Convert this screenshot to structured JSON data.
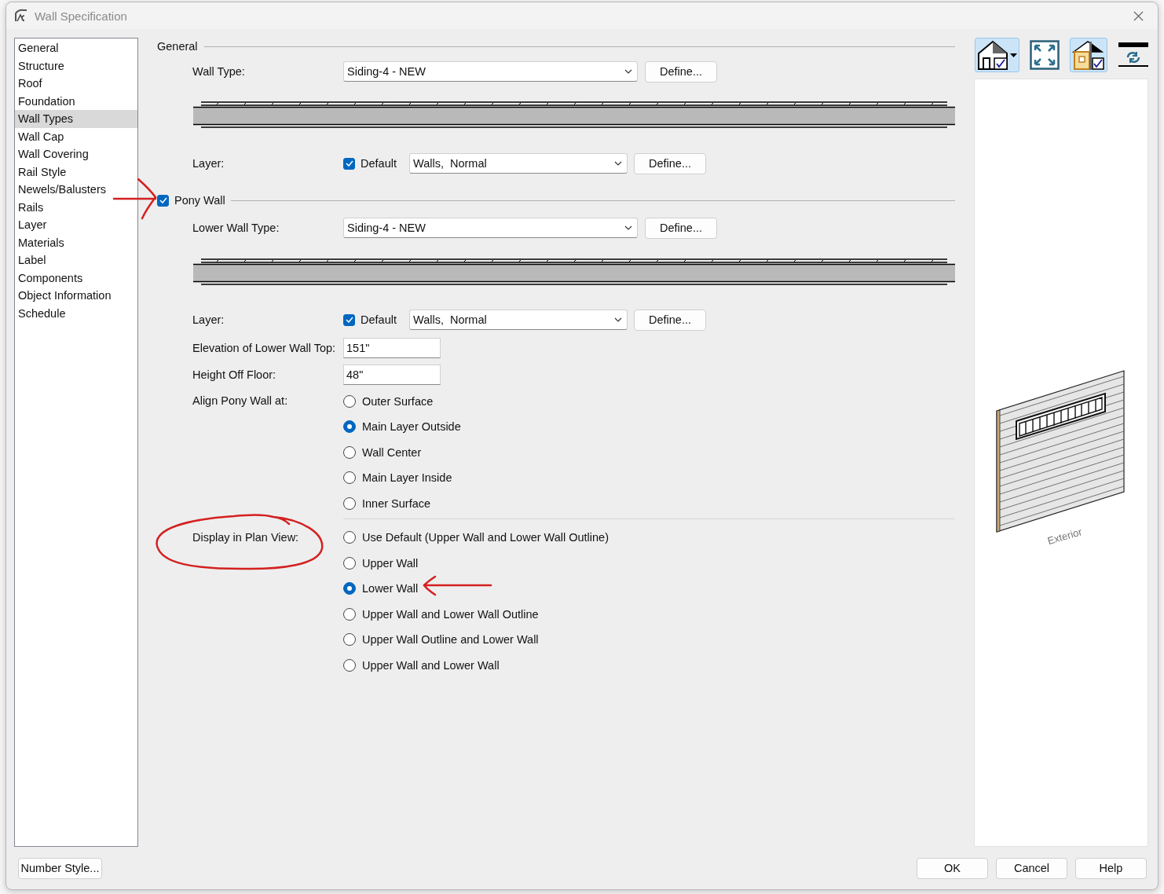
{
  "window": {
    "title": "Wall Specification"
  },
  "sidebar": {
    "items": [
      {
        "label": "General",
        "selected": false
      },
      {
        "label": "Structure",
        "selected": false
      },
      {
        "label": "Roof",
        "selected": false
      },
      {
        "label": "Foundation",
        "selected": false
      },
      {
        "label": "Wall Types",
        "selected": true
      },
      {
        "label": "Wall Cap",
        "selected": false
      },
      {
        "label": "Wall Covering",
        "selected": false
      },
      {
        "label": "Rail Style",
        "selected": false
      },
      {
        "label": "Newels/Balusters",
        "selected": false
      },
      {
        "label": "Rails",
        "selected": false
      },
      {
        "label": "Layer",
        "selected": false
      },
      {
        "label": "Materials",
        "selected": false
      },
      {
        "label": "Label",
        "selected": false
      },
      {
        "label": "Components",
        "selected": false
      },
      {
        "label": "Object Information",
        "selected": false
      },
      {
        "label": "Schedule",
        "selected": false
      }
    ]
  },
  "general": {
    "heading": "General",
    "wall_type": {
      "label": "Wall Type:",
      "value": "Siding-4 - NEW",
      "button": "Define..."
    },
    "layer": {
      "label": "Layer:",
      "default_checked": true,
      "default_label": "Default",
      "value": "Walls,  Normal",
      "button": "Define..."
    }
  },
  "pony_wall": {
    "label": "Pony Wall",
    "checked": true,
    "lower_wall_type": {
      "label": "Lower Wall Type:",
      "value": "Siding-4 - NEW",
      "button": "Define..."
    },
    "layer": {
      "label": "Layer:",
      "default_checked": true,
      "default_label": "Default",
      "value": "Walls,  Normal",
      "button": "Define..."
    },
    "elevation": {
      "label": "Elevation of Lower Wall Top:",
      "value": "151\""
    },
    "height_off_floor": {
      "label": "Height Off Floor:",
      "value": "48\""
    },
    "align": {
      "label": "Align Pony Wall at:",
      "options": [
        {
          "label": "Outer Surface",
          "selected": false
        },
        {
          "label": "Main Layer Outside",
          "selected": true
        },
        {
          "label": "Wall Center",
          "selected": false
        },
        {
          "label": "Main Layer Inside",
          "selected": false
        },
        {
          "label": "Inner Surface",
          "selected": false
        }
      ]
    },
    "display": {
      "label": "Display in Plan View:",
      "options": [
        {
          "label": "Use Default (Upper Wall and Lower Wall Outline)",
          "selected": false
        },
        {
          "label": "Upper Wall",
          "selected": false
        },
        {
          "label": "Lower Wall",
          "selected": true
        },
        {
          "label": "Upper Wall and Lower Wall Outline",
          "selected": false
        },
        {
          "label": "Upper Wall Outline and Lower Wall",
          "selected": false
        },
        {
          "label": "Upper Wall and Lower Wall",
          "selected": false
        }
      ]
    }
  },
  "toolbar": [
    {
      "kind": "house-view",
      "selected": true
    },
    {
      "kind": "fill-window",
      "selected": false
    },
    {
      "kind": "layer-view",
      "selected": true
    },
    {
      "kind": "reverse",
      "selected": false
    }
  ],
  "preview": {
    "caption": "Exterior"
  },
  "footer": {
    "number_style": "Number Style...",
    "ok": "OK",
    "cancel": "Cancel",
    "help": "Help"
  }
}
